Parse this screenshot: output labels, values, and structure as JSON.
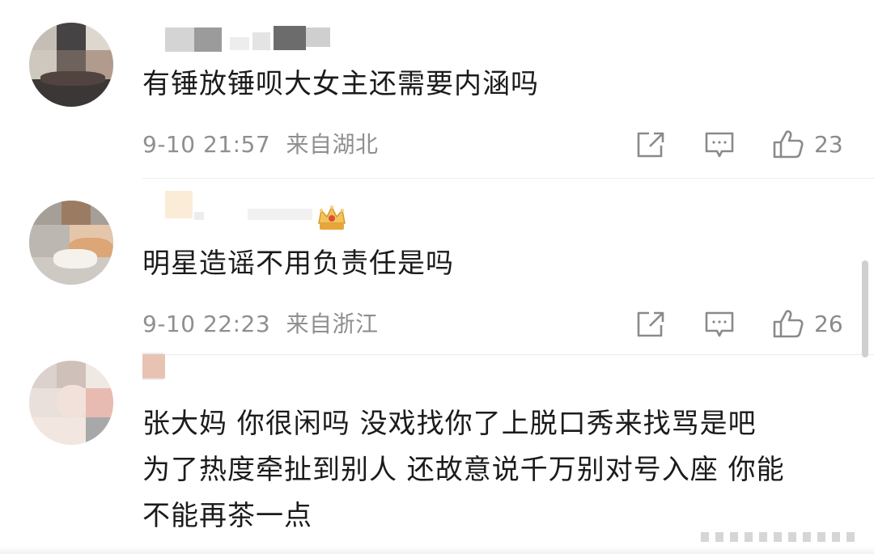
{
  "comments": [
    {
      "username": "",
      "text": "有锤放锤呗大女主还需要内涵吗",
      "time": "9-10 21:57",
      "location": "来自湖北",
      "likes": "23",
      "icons": {
        "share": "share-icon",
        "reply": "comment-icon",
        "like": "thumbs-up-icon"
      }
    },
    {
      "username": "",
      "text": "明星造谣不用负责任是吗",
      "time": "9-10 22:23",
      "location": "来自浙江",
      "likes": "26",
      "badge": "crown-badge-icon",
      "icons": {
        "share": "share-icon",
        "reply": "comment-icon",
        "like": "thumbs-up-icon"
      }
    },
    {
      "username": "",
      "text": "张大妈 你很闲吗 没戏找你了上脱口秀来找骂是吧\n为了热度牵扯到别人 还故意说千万别对号入座 你能\n不能再茶一点"
    }
  ],
  "colors": {
    "text": "#1b1b1b",
    "meta": "#8f8f8f",
    "icon": "#8a8a8a",
    "badge": "#e9b44c",
    "background": "#ffffff"
  }
}
